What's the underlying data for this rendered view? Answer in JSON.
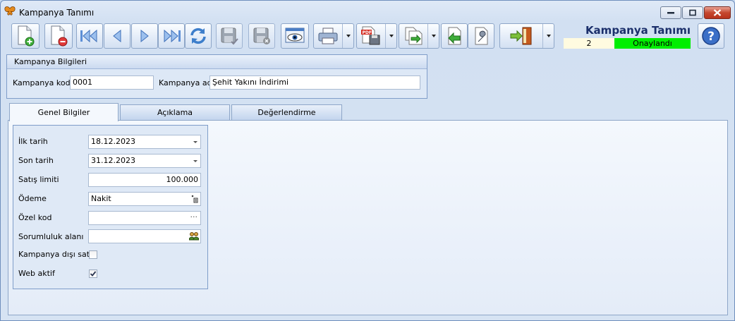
{
  "window": {
    "title": "Kampanya Tanımı"
  },
  "toolbar": {
    "buttons": [
      "new-record-icon",
      "delete-record-icon",
      "first-record-icon",
      "previous-record-icon",
      "next-record-icon",
      "last-record-icon",
      "refresh-icon",
      "save-icon",
      "cancel-save-icon",
      "preview-icon",
      "print-icon",
      "pdf-export-icon",
      "export-icon",
      "import-icon",
      "settings-icon",
      "exit-icon",
      "help-icon"
    ]
  },
  "header": {
    "title": "Kampanya Tanımı",
    "record_no": "2",
    "status": "Onaylandı",
    "status_color": "#00ee00"
  },
  "group": {
    "title": "Kampanya Bilgileri",
    "code_label": "Kampanya kodu",
    "code_value": "0001",
    "name_label": "Kampanya adı",
    "name_value": "Şehit Yakını İndirimi"
  },
  "tabs": [
    "Genel Bilgiler",
    "Açıklama",
    "Değerlendirme"
  ],
  "general": {
    "start_date_label": "İlk tarih",
    "start_date": "18.12.2023",
    "end_date_label": "Son tarih",
    "end_date": "31.12.2023",
    "sales_limit_label": "Satış limiti",
    "sales_limit": "100.000",
    "payment_label": "Ödeme",
    "payment": "Nakit",
    "special_code_label": "Özel kod",
    "special_code": "",
    "responsibility_label": "Sorumluluk alanı",
    "responsibility": "",
    "out_of_campaign_label": "Kampanya dışı satış",
    "out_of_campaign": false,
    "web_active_label": "Web aktif",
    "web_active": true
  }
}
